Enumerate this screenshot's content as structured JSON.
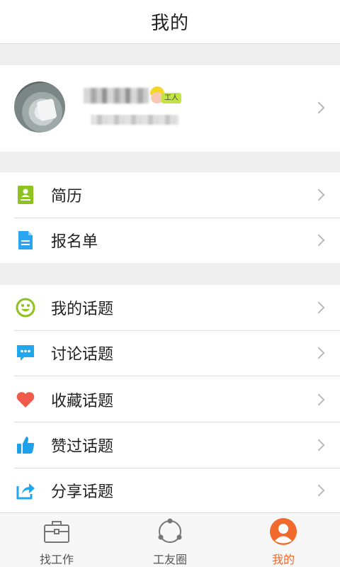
{
  "header": {
    "title": "我的"
  },
  "profile": {
    "badge_text": "工人"
  },
  "menu_group_1": [
    {
      "label": "简历",
      "icon": "resume-icon"
    },
    {
      "label": "报名单",
      "icon": "document-icon"
    }
  ],
  "menu_group_2": [
    {
      "label": "我的话题",
      "icon": "smile-icon"
    },
    {
      "label": "讨论话题",
      "icon": "chat-bubble-icon"
    },
    {
      "label": "收藏话题",
      "icon": "heart-icon"
    },
    {
      "label": "赞过话题",
      "icon": "thumbs-up-icon"
    },
    {
      "label": "分享话题",
      "icon": "share-icon"
    }
  ],
  "tabbar": [
    {
      "label": "找工作",
      "icon": "briefcase-icon",
      "active": false
    },
    {
      "label": "工友圈",
      "icon": "circle-network-icon",
      "active": false
    },
    {
      "label": "我的",
      "icon": "user-icon",
      "active": true
    }
  ],
  "colors": {
    "accent_active": "#f06a2e",
    "resume_green": "#8ec21f",
    "doc_blue": "#2aa5f0",
    "smile_green": "#8ec21f",
    "chat_blue": "#1fa8ee",
    "heart_red": "#ef5a4a",
    "thumb_blue": "#1fa0ea",
    "share_blue": "#1fa8ee"
  }
}
